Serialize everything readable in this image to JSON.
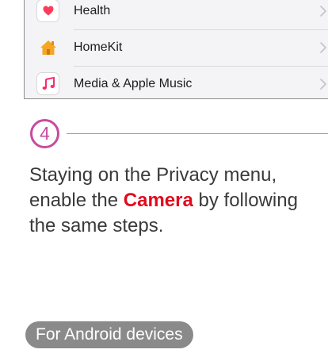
{
  "settings_list": {
    "items": [
      {
        "label": "Health",
        "icon": "health-heart-icon",
        "icon_color": "#ff3b5c"
      },
      {
        "label": "HomeKit",
        "icon": "homekit-house-icon",
        "icon_color": "#f5a623"
      },
      {
        "label": "Media & Apple Music",
        "icon": "music-note-icon",
        "icon_color": "#fa2d6b"
      }
    ]
  },
  "step": {
    "number": "4",
    "accent_color": "#c74ba1",
    "text_before": "Staying on the Privacy menu, enable the ",
    "highlight": "Camera",
    "highlight_color": "#e10a1e",
    "text_after": " by following the same steps."
  },
  "android_section": {
    "label": "For Android devices"
  }
}
